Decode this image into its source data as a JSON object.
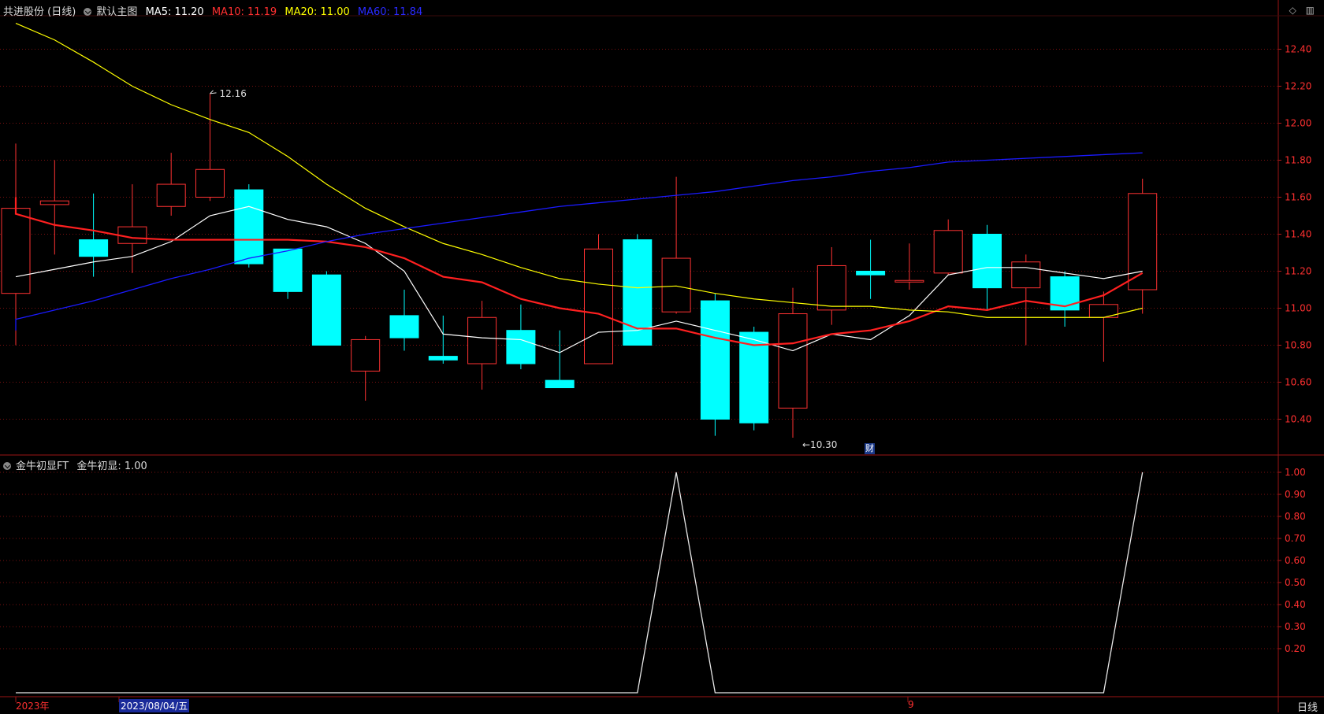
{
  "header": {
    "stock": "共进股份 (日线)",
    "template": "默认主图",
    "ma5_label": "MA5: 11.20",
    "ma10_label": "MA10: 11.19",
    "ma20_label": "MA20: 11.00",
    "ma60_label": "MA60: 11.84"
  },
  "indicator_header": {
    "name": "金牛初显FT",
    "value_label": "金牛初显: 1.00"
  },
  "bottom": {
    "year": "2023年",
    "date": "2023/08/04/五",
    "month_marker": "9",
    "period": "日线"
  },
  "finance_marker": "财",
  "colors": {
    "up": "#ff3232",
    "down": "#00ffff",
    "ma5": "#ffffff",
    "ma10": "#ff2020",
    "ma20": "#ffff00",
    "ma60": "#1a1aff",
    "grid": "#7a1010"
  },
  "chart_data": [
    {
      "type": "candlestick",
      "title": "共进股份 (日线)",
      "ylim": [
        10.2,
        12.55
      ],
      "yticks": [
        "12.40",
        "12.20",
        "12.00",
        "11.80",
        "11.60",
        "11.40",
        "11.20",
        "11.00",
        "10.80",
        "10.60",
        "10.40"
      ],
      "annotations": [
        {
          "text": "12.16",
          "index": 5,
          "value": 12.16
        },
        {
          "text": "10.30",
          "index": 20,
          "value": 10.3
        }
      ],
      "candles": [
        {
          "o": 11.08,
          "h": 11.89,
          "l": 10.8,
          "c": 11.54
        },
        {
          "o": 11.56,
          "h": 11.8,
          "l": 11.29,
          "c": 11.58
        },
        {
          "o": 11.37,
          "h": 11.62,
          "l": 11.17,
          "c": 11.28
        },
        {
          "o": 11.35,
          "h": 11.67,
          "l": 11.19,
          "c": 11.44
        },
        {
          "o": 11.55,
          "h": 11.84,
          "l": 11.5,
          "c": 11.67
        },
        {
          "o": 11.6,
          "h": 12.16,
          "l": 11.58,
          "c": 11.75
        },
        {
          "o": 11.64,
          "h": 11.67,
          "l": 11.22,
          "c": 11.24
        },
        {
          "o": 11.32,
          "h": 11.32,
          "l": 11.05,
          "c": 11.09
        },
        {
          "o": 11.18,
          "h": 11.2,
          "l": 10.8,
          "c": 10.8
        },
        {
          "o": 10.66,
          "h": 10.85,
          "l": 10.5,
          "c": 10.83
        },
        {
          "o": 10.96,
          "h": 11.1,
          "l": 10.77,
          "c": 10.84
        },
        {
          "o": 10.74,
          "h": 10.96,
          "l": 10.7,
          "c": 10.72
        },
        {
          "o": 10.7,
          "h": 11.04,
          "l": 10.56,
          "c": 10.95
        },
        {
          "o": 10.88,
          "h": 11.02,
          "l": 10.67,
          "c": 10.7
        },
        {
          "o": 10.61,
          "h": 10.88,
          "l": 10.58,
          "c": 10.57
        },
        {
          "o": 10.7,
          "h": 11.4,
          "l": 10.7,
          "c": 11.32
        },
        {
          "o": 11.37,
          "h": 11.4,
          "l": 10.8,
          "c": 10.8
        },
        {
          "o": 10.98,
          "h": 11.71,
          "l": 10.97,
          "c": 11.27
        },
        {
          "o": 11.04,
          "h": 11.08,
          "l": 10.31,
          "c": 10.4
        },
        {
          "o": 10.87,
          "h": 10.9,
          "l": 10.34,
          "c": 10.38
        },
        {
          "o": 10.46,
          "h": 11.11,
          "l": 10.3,
          "c": 10.97
        },
        {
          "o": 10.99,
          "h": 11.33,
          "l": 10.91,
          "c": 11.23
        },
        {
          "o": 11.2,
          "h": 11.37,
          "l": 11.05,
          "c": 11.18
        },
        {
          "o": 11.15,
          "h": 11.35,
          "l": 11.1,
          "c": 11.15
        },
        {
          "o": 11.19,
          "h": 11.48,
          "l": 11.18,
          "c": 11.42
        },
        {
          "o": 11.4,
          "h": 11.45,
          "l": 10.99,
          "c": 11.11
        },
        {
          "o": 11.11,
          "h": 11.29,
          "l": 10.8,
          "c": 11.25
        },
        {
          "o": 11.17,
          "h": 11.2,
          "l": 10.9,
          "c": 10.99
        },
        {
          "o": 10.95,
          "h": 11.09,
          "l": 10.71,
          "c": 11.02
        },
        {
          "o": 11.1,
          "h": 11.7,
          "l": 10.97,
          "c": 11.62
        }
      ],
      "series": [
        {
          "name": "MA5",
          "values": [
            11.17,
            11.21,
            11.25,
            11.28,
            11.36,
            11.5,
            11.55,
            11.48,
            11.44,
            11.35,
            11.2,
            10.86,
            10.84,
            10.83,
            10.76,
            10.87,
            10.88,
            10.93,
            10.88,
            10.83,
            10.77,
            10.86,
            10.83,
            10.96,
            11.18,
            11.22,
            11.22,
            11.19,
            11.16,
            11.2
          ]
        },
        {
          "name": "MA10",
          "values": [
            11.6,
            11.51,
            11.45,
            11.42,
            11.38,
            11.37,
            11.37,
            11.37,
            11.37,
            11.36,
            11.33,
            11.27,
            11.17,
            11.14,
            11.05,
            11.0,
            10.97,
            10.89,
            10.89,
            10.84,
            10.8,
            10.81,
            10.86,
            10.88,
            10.93,
            11.01,
            10.99,
            11.04,
            11.01,
            11.07,
            11.19
          ]
        },
        {
          "name": "MA20",
          "values": [
            12.54,
            12.45,
            12.33,
            12.2,
            12.1,
            12.02,
            11.95,
            11.82,
            11.67,
            11.54,
            11.44,
            11.35,
            11.29,
            11.22,
            11.16,
            11.13,
            11.11,
            11.12,
            11.08,
            11.05,
            11.03,
            11.01,
            11.01,
            10.99,
            10.98,
            10.95,
            10.95,
            10.95,
            10.95,
            11.0
          ]
        },
        {
          "name": "MA60",
          "values": [
            10.88,
            10.94,
            10.99,
            11.04,
            11.1,
            11.16,
            11.21,
            11.27,
            11.31,
            11.36,
            11.4,
            11.43,
            11.46,
            11.49,
            11.52,
            11.55,
            11.57,
            11.59,
            11.61,
            11.63,
            11.66,
            11.69,
            11.71,
            11.74,
            11.76,
            11.79,
            11.8,
            11.81,
            11.82,
            11.83,
            11.84
          ]
        }
      ]
    },
    {
      "type": "line",
      "title": "金牛初显FT",
      "ylim": [
        0,
        1.05
      ],
      "yticks": [
        "1.00",
        "0.90",
        "0.80",
        "0.70",
        "0.60",
        "0.50",
        "0.40",
        "0.30",
        "0.20"
      ],
      "series": [
        {
          "name": "金牛初显",
          "values": [
            0,
            0,
            0,
            0,
            0,
            0,
            0,
            0,
            0,
            0,
            0,
            0,
            0,
            0,
            0,
            0,
            0,
            1,
            0,
            0,
            0,
            0,
            0,
            0,
            0,
            0,
            0,
            0,
            0,
            1
          ]
        }
      ]
    }
  ]
}
